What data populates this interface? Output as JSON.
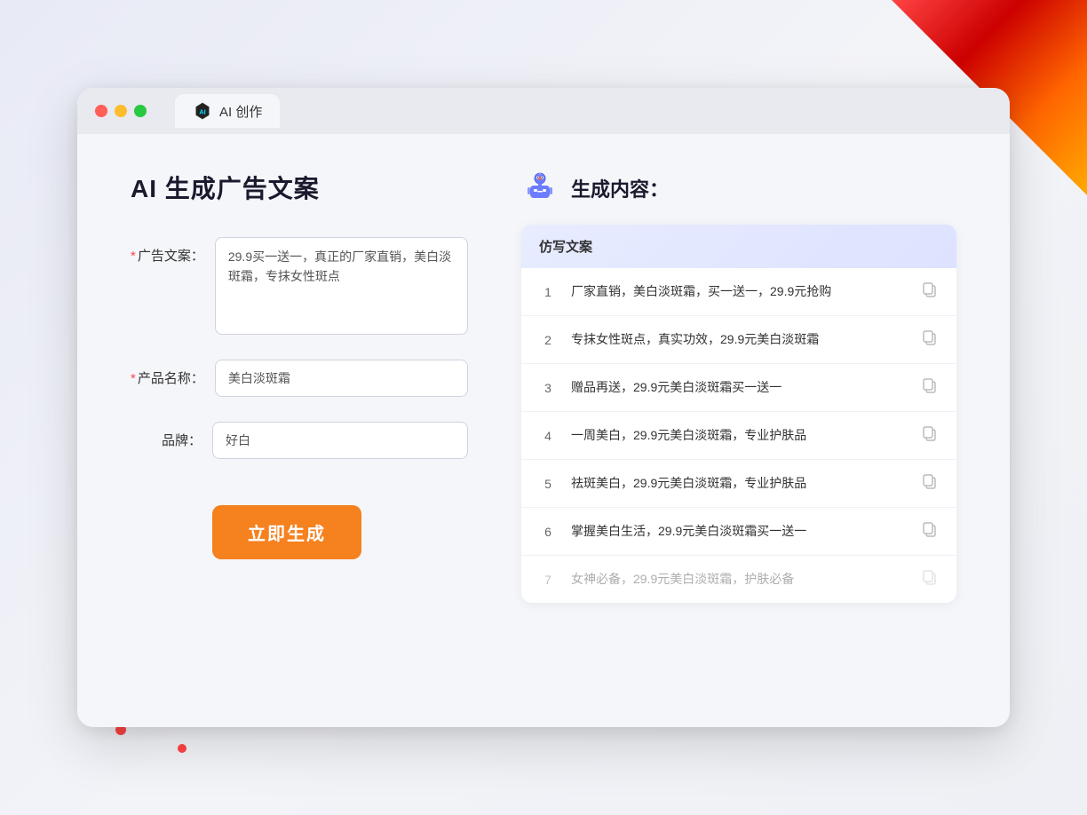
{
  "browser": {
    "tab_label": "AI 创作",
    "traffic_lights": [
      "red",
      "yellow",
      "green"
    ]
  },
  "page": {
    "title": "AI 生成广告文案",
    "form": {
      "ad_copy_label": "广告文案：",
      "ad_copy_required": true,
      "ad_copy_value": "29.9买一送一，真正的厂家直销，美白淡斑霜，专抹女性斑点",
      "product_name_label": "产品名称：",
      "product_name_required": true,
      "product_name_value": "美白淡斑霜",
      "brand_label": "品牌：",
      "brand_required": false,
      "brand_value": "好白",
      "generate_btn_label": "立即生成"
    },
    "result": {
      "header_label": "生成内容：",
      "table_header": "仿写文案",
      "items": [
        {
          "id": 1,
          "text": "厂家直销，美白淡斑霜，买一送一，29.9元抢购",
          "faded": false
        },
        {
          "id": 2,
          "text": "专抹女性斑点，真实功效，29.9元美白淡斑霜",
          "faded": false
        },
        {
          "id": 3,
          "text": "赠品再送，29.9元美白淡斑霜买一送一",
          "faded": false
        },
        {
          "id": 4,
          "text": "一周美白，29.9元美白淡斑霜，专业护肤品",
          "faded": false
        },
        {
          "id": 5,
          "text": "祛斑美白，29.9元美白淡斑霜，专业护肤品",
          "faded": false
        },
        {
          "id": 6,
          "text": "掌握美白生活，29.9元美白淡斑霜买一送一",
          "faded": false
        },
        {
          "id": 7,
          "text": "女神必备，29.9元美白淡斑霜，护肤必备",
          "faded": true
        }
      ]
    }
  }
}
